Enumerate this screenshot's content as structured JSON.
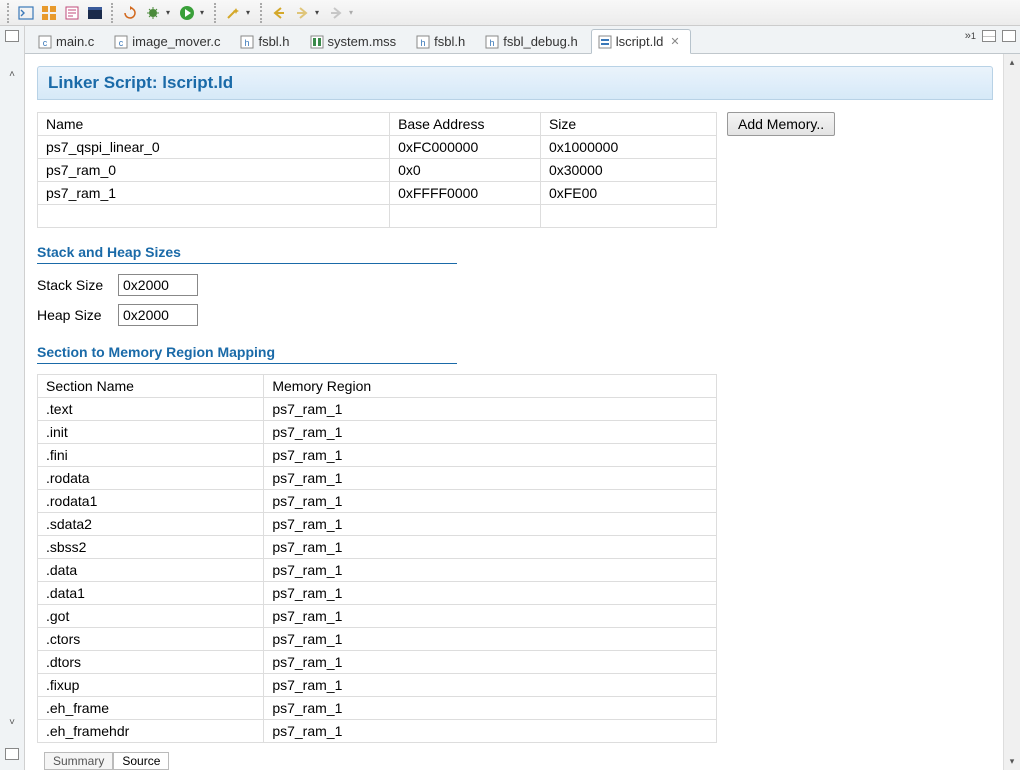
{
  "toolbar": {},
  "tabs": [
    {
      "label": "main.c",
      "icon_type": "c"
    },
    {
      "label": "image_mover.c",
      "icon_type": "c"
    },
    {
      "label": "fsbl.h",
      "icon_type": "h"
    },
    {
      "label": "system.mss",
      "icon_type": "mss"
    },
    {
      "label": "fsbl.h",
      "icon_type": "h"
    },
    {
      "label": "fsbl_debug.h",
      "icon_type": "h"
    },
    {
      "label": "lscript.ld",
      "icon_type": "ld",
      "active": true
    }
  ],
  "tab_overflow_count": "1",
  "page": {
    "title": "Linker Script: lscript.ld",
    "memory_table": {
      "headers": [
        "Name",
        "Base Address",
        "Size"
      ],
      "rows": [
        [
          "ps7_qspi_linear_0",
          "0xFC000000",
          "0x1000000"
        ],
        [
          "ps7_ram_0",
          "0x0",
          "0x30000"
        ],
        [
          "ps7_ram_1",
          "0xFFFF0000",
          "0xFE00"
        ]
      ]
    },
    "add_memory_label": "Add Memory..",
    "stack_heap_heading": "Stack and Heap Sizes",
    "stack_label": "Stack Size",
    "stack_value": "0x2000",
    "heap_label": "Heap Size",
    "heap_value": "0x2000",
    "section_mapping_heading": "Section to Memory Region Mapping",
    "section_table": {
      "headers": [
        "Section Name",
        "Memory Region"
      ],
      "rows": [
        [
          ".text",
          "ps7_ram_1"
        ],
        [
          ".init",
          "ps7_ram_1"
        ],
        [
          ".fini",
          "ps7_ram_1"
        ],
        [
          ".rodata",
          "ps7_ram_1"
        ],
        [
          ".rodata1",
          "ps7_ram_1"
        ],
        [
          ".sdata2",
          "ps7_ram_1"
        ],
        [
          ".sbss2",
          "ps7_ram_1"
        ],
        [
          ".data",
          "ps7_ram_1"
        ],
        [
          ".data1",
          "ps7_ram_1"
        ],
        [
          ".got",
          "ps7_ram_1"
        ],
        [
          ".ctors",
          "ps7_ram_1"
        ],
        [
          ".dtors",
          "ps7_ram_1"
        ],
        [
          ".fixup",
          "ps7_ram_1"
        ],
        [
          ".eh_frame",
          "ps7_ram_1"
        ],
        [
          ".eh_framehdr",
          "ps7_ram_1"
        ]
      ]
    }
  },
  "bottom_tabs": {
    "summary": "Summary",
    "source": "Source"
  }
}
